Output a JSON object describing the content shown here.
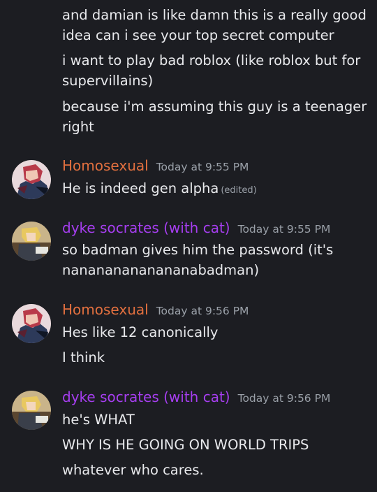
{
  "colors": {
    "background": "#1c1d22",
    "user_homosexual": "#e3703f",
    "user_dyke_socrates": "#a63ef0",
    "timestamp": "#9aa0a8",
    "text": "#e8e9ec"
  },
  "earlier_messages": [
    "and damian is like damn this is a really good",
    "idea can i see your top secret computer",
    "i want to play bad roblox (like roblox but for",
    "supervillains)",
    "because i'm assuming this guy is a teenager",
    "right"
  ],
  "groups": [
    {
      "username": "Homosexual",
      "timestamp": "Today at 9:55 PM",
      "avatar": "red-haired-character-avatar",
      "lines": [
        "He is indeed gen alpha"
      ],
      "edited_label": "(edited)"
    },
    {
      "username": "dyke socrates (with cat)",
      "timestamp": "Today at 9:55 PM",
      "avatar": "blonde-character-avatar",
      "lines": [
        "so badman gives him the password (it's",
        "nanananananananabadman)"
      ]
    },
    {
      "username": "Homosexual",
      "timestamp": "Today at 9:56 PM",
      "avatar": "red-haired-character-avatar",
      "lines": [
        "Hes like 12 canonically",
        "I think"
      ]
    },
    {
      "username": "dyke socrates (with cat)",
      "timestamp": "Today at 9:56 PM",
      "avatar": "blonde-character-avatar",
      "lines": [
        "he's WHAT",
        "WHY IS HE GOING ON WORLD TRIPS",
        "whatever who cares."
      ]
    }
  ]
}
